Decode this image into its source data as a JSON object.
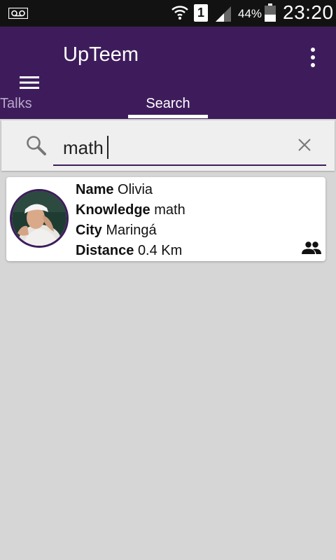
{
  "status_bar": {
    "sim_slot": "1",
    "battery_percent": "44%",
    "battery_level": 0.44,
    "time": "23:20",
    "icons": [
      "voicemail-icon",
      "wifi-icon",
      "signal-icon",
      "battery-icon"
    ]
  },
  "app_bar": {
    "title": "UpTeem",
    "menu_icon": "hamburger-menu-icon",
    "overflow_icon": "more-vert-icon",
    "brand_color": "#3e1c5c"
  },
  "tabs": [
    {
      "label": "Talks",
      "selected": false
    },
    {
      "label": "Search",
      "selected": true
    }
  ],
  "search": {
    "value": "math",
    "placeholder": "",
    "search_icon": "search-icon",
    "clear_icon": "close-icon"
  },
  "results": [
    {
      "name_label": "Name",
      "name": "Olivia",
      "knowledge_label": "Knowledge",
      "knowledge": "math",
      "city_label": "City",
      "city": "Maringá",
      "distance_label": "Distance",
      "distance": "0.4 Km",
      "action_icon": "group-icon"
    }
  ]
}
